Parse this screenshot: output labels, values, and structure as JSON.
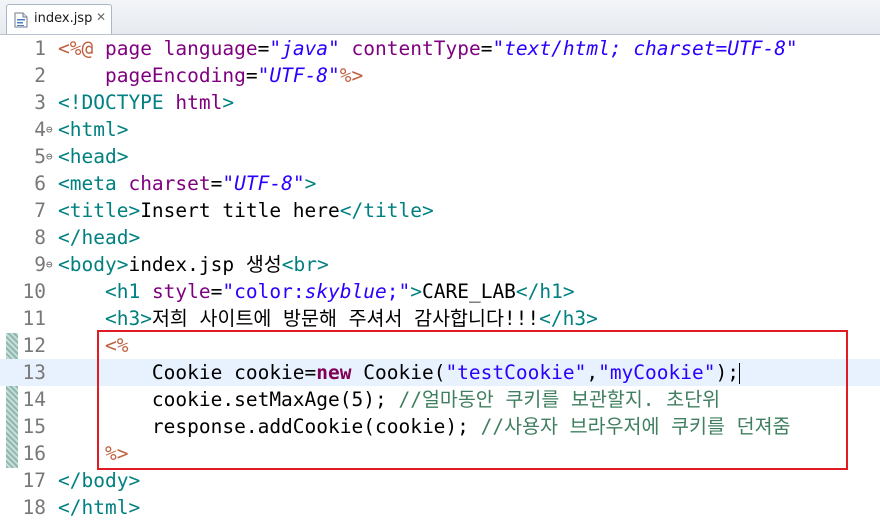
{
  "tab": {
    "title": "index.jsp",
    "close": "✕"
  },
  "lines": [
    {
      "n": "1",
      "fold": "",
      "parts": [
        [
          "scr",
          "<%@ "
        ],
        [
          "attr",
          "page "
        ],
        [
          "attr",
          "language"
        ],
        [
          "txt",
          "="
        ],
        [
          "str",
          "\"java\""
        ],
        [
          "txt",
          " "
        ],
        [
          "attr",
          "contentType"
        ],
        [
          "txt",
          "="
        ],
        [
          "str",
          "\"text/html; charset=UTF-8\""
        ]
      ]
    },
    {
      "n": "2",
      "fold": "",
      "parts": [
        [
          "txt",
          "    "
        ],
        [
          "attr",
          "pageEncoding"
        ],
        [
          "txt",
          "="
        ],
        [
          "str",
          "\"UTF-8\""
        ],
        [
          "scr",
          "%>"
        ]
      ]
    },
    {
      "n": "3",
      "fold": "",
      "parts": [
        [
          "tag",
          "<!DOCTYPE "
        ],
        [
          "attr",
          "html"
        ],
        [
          "tag",
          ">"
        ]
      ]
    },
    {
      "n": "4",
      "fold": "⊖",
      "parts": [
        [
          "tag",
          "<html>"
        ]
      ]
    },
    {
      "n": "5",
      "fold": "⊖",
      "parts": [
        [
          "tag",
          "<head>"
        ]
      ]
    },
    {
      "n": "6",
      "fold": "",
      "parts": [
        [
          "tag",
          "<meta "
        ],
        [
          "attr",
          "charset"
        ],
        [
          "txt",
          "="
        ],
        [
          "str",
          "\"UTF-8\""
        ],
        [
          "tag",
          ">"
        ]
      ]
    },
    {
      "n": "7",
      "fold": "",
      "parts": [
        [
          "tag",
          "<title>"
        ],
        [
          "txt",
          "Insert title here"
        ],
        [
          "tag",
          "</title>"
        ]
      ]
    },
    {
      "n": "8",
      "fold": "",
      "parts": [
        [
          "tag",
          "</head>"
        ]
      ]
    },
    {
      "n": "9",
      "fold": "⊖",
      "parts": [
        [
          "tag",
          "<body>"
        ],
        [
          "txt",
          "index.jsp 생성"
        ],
        [
          "tag",
          "<br>"
        ]
      ]
    },
    {
      "n": "10",
      "fold": "",
      "parts": [
        [
          "txt",
          "    "
        ],
        [
          "tag",
          "<h1 "
        ],
        [
          "attr",
          "style"
        ],
        [
          "txt",
          "="
        ],
        [
          "dq",
          "\"color:"
        ],
        [
          "str",
          "skyblue"
        ],
        [
          "dq",
          ";\""
        ],
        [
          "tag",
          ">"
        ],
        [
          "txt",
          "CARE_LAB"
        ],
        [
          "tag",
          "</h1>"
        ]
      ]
    },
    {
      "n": "11",
      "fold": "",
      "parts": [
        [
          "txt",
          "    "
        ],
        [
          "tag",
          "<h3>"
        ],
        [
          "txt",
          "저희 사이트에 방문해 주셔서 감사합니다!!!"
        ],
        [
          "tag",
          "</h3>"
        ]
      ]
    },
    {
      "n": "12",
      "fold": "",
      "parts": [
        [
          "txt",
          "    "
        ],
        [
          "scr",
          "<%"
        ]
      ]
    },
    {
      "n": "13",
      "fold": "",
      "current": true,
      "parts": [
        [
          "txt",
          "        Cookie cookie="
        ],
        [
          "kw",
          "new"
        ],
        [
          "txt",
          " Cookie("
        ],
        [
          "jstr",
          "\"testCookie\""
        ],
        [
          "txt",
          ","
        ],
        [
          "jstr",
          "\"myCookie\""
        ],
        [
          "txt",
          ");"
        ],
        [
          "caret",
          ""
        ]
      ]
    },
    {
      "n": "14",
      "fold": "",
      "parts": [
        [
          "txt",
          "        cookie.setMaxAge(5); "
        ],
        [
          "cm",
          "//얼마동안 쿠키를 보관할지. 초단위"
        ]
      ]
    },
    {
      "n": "15",
      "fold": "",
      "parts": [
        [
          "txt",
          "        response.addCookie(cookie); "
        ],
        [
          "cm",
          "//사용자 브라우저에 쿠키를 던져줌"
        ]
      ]
    },
    {
      "n": "16",
      "fold": "",
      "parts": [
        [
          "txt",
          "    "
        ],
        [
          "scr",
          "%>"
        ]
      ]
    },
    {
      "n": "17",
      "fold": "",
      "parts": [
        [
          "tag",
          "</body>"
        ]
      ]
    },
    {
      "n": "18",
      "fold": "",
      "parts": [
        [
          "tag",
          "</html>"
        ]
      ]
    }
  ]
}
